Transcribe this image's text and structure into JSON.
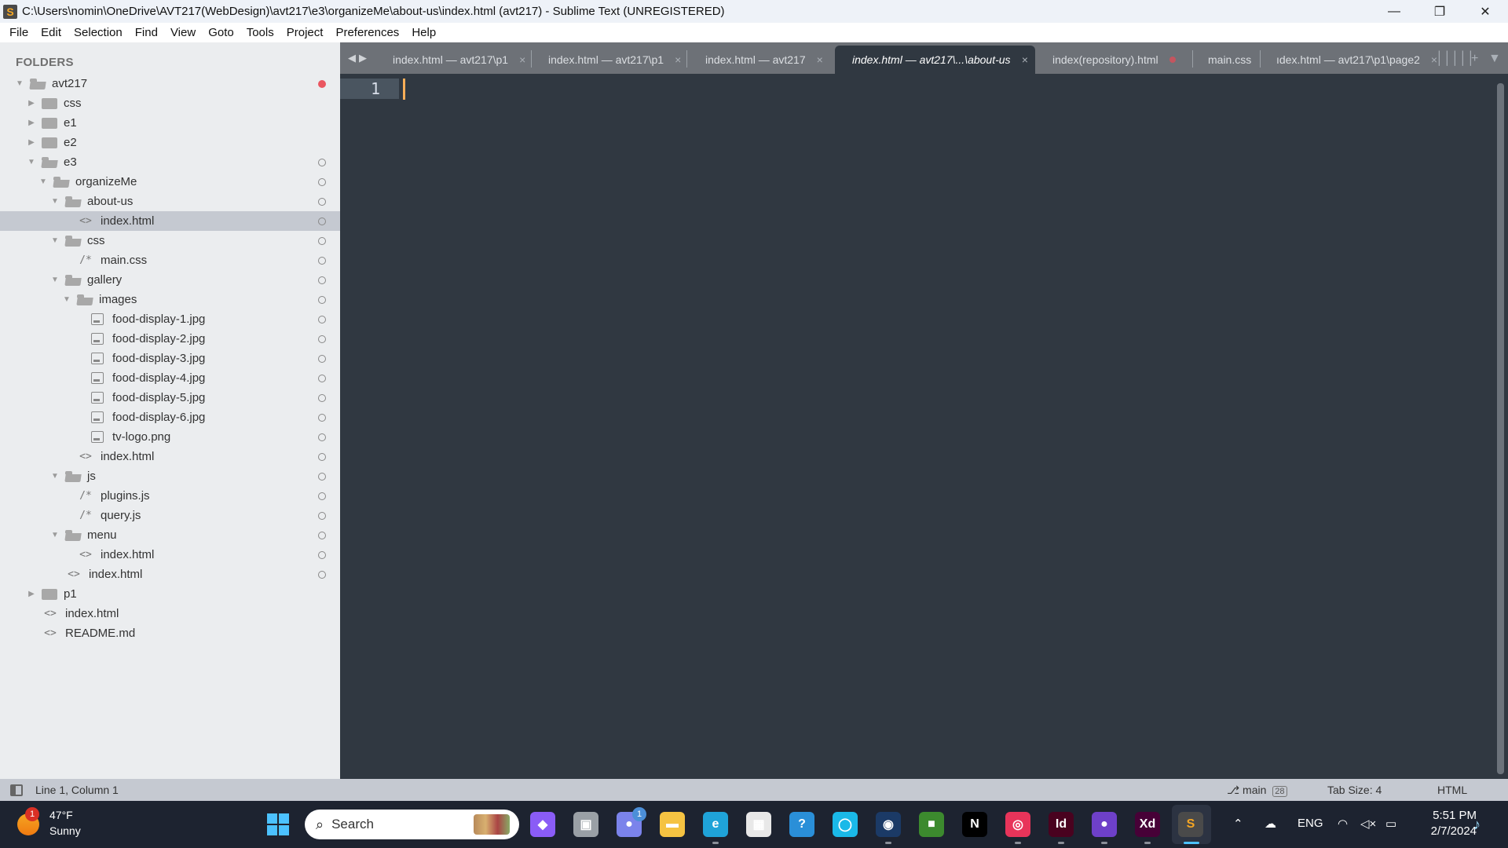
{
  "window": {
    "title": "C:\\Users\\nomin\\OneDrive\\AVT217(WebDesign)\\avt217\\e3\\organizeMe\\about-us\\index.html (avt217) - Sublime Text (UNREGISTERED)",
    "app_icon": "sublime-text-icon",
    "controls": {
      "minimize": "—",
      "maximize": "❐",
      "close": "✕"
    }
  },
  "menu": [
    "File",
    "Edit",
    "Selection",
    "Find",
    "View",
    "Goto",
    "Tools",
    "Project",
    "Preferences",
    "Help"
  ],
  "sidebar": {
    "header": "FOLDERS",
    "tree": [
      {
        "label": "avt217",
        "type": "folder",
        "open": true,
        "depth": 0,
        "status": "modified"
      },
      {
        "label": "css",
        "type": "folder",
        "open": false,
        "depth": 1,
        "status": ""
      },
      {
        "label": "e1",
        "type": "folder",
        "open": false,
        "depth": 1,
        "status": ""
      },
      {
        "label": "e2",
        "type": "folder",
        "open": false,
        "depth": 1,
        "status": ""
      },
      {
        "label": "e3",
        "type": "folder",
        "open": true,
        "depth": 1,
        "status": "clean"
      },
      {
        "label": "organizeMe",
        "type": "folder",
        "open": true,
        "depth": 2,
        "status": "clean"
      },
      {
        "label": "about-us",
        "type": "folder",
        "open": true,
        "depth": 3,
        "status": "clean"
      },
      {
        "label": "index.html",
        "type": "html",
        "depth": 4,
        "status": "clean",
        "selected": true
      },
      {
        "label": "css",
        "type": "folder",
        "open": true,
        "depth": 3,
        "status": "clean"
      },
      {
        "label": "main.css",
        "type": "code",
        "depth": 4,
        "status": "clean"
      },
      {
        "label": "gallery",
        "type": "folder",
        "open": true,
        "depth": 3,
        "status": "clean"
      },
      {
        "label": "images",
        "type": "folder",
        "open": true,
        "depth": 4,
        "status": "clean"
      },
      {
        "label": "food-display-1.jpg",
        "type": "image",
        "depth": 5,
        "status": "clean"
      },
      {
        "label": "food-display-2.jpg",
        "type": "image",
        "depth": 5,
        "status": "clean"
      },
      {
        "label": "food-display-3.jpg",
        "type": "image",
        "depth": 5,
        "status": "clean"
      },
      {
        "label": "food-display-4.jpg",
        "type": "image",
        "depth": 5,
        "status": "clean"
      },
      {
        "label": "food-display-5.jpg",
        "type": "image",
        "depth": 5,
        "status": "clean"
      },
      {
        "label": "food-display-6.jpg",
        "type": "image",
        "depth": 5,
        "status": "clean"
      },
      {
        "label": "tv-logo.png",
        "type": "image",
        "depth": 5,
        "status": "clean"
      },
      {
        "label": "index.html",
        "type": "html",
        "depth": 4,
        "status": "clean"
      },
      {
        "label": "js",
        "type": "folder",
        "open": true,
        "depth": 3,
        "status": "clean"
      },
      {
        "label": "plugins.js",
        "type": "code",
        "depth": 4,
        "status": "clean"
      },
      {
        "label": "query.js",
        "type": "code",
        "depth": 4,
        "status": "clean"
      },
      {
        "label": "menu",
        "type": "folder",
        "open": true,
        "depth": 3,
        "status": "clean"
      },
      {
        "label": "index.html",
        "type": "html",
        "depth": 4,
        "status": "clean"
      },
      {
        "label": "index.html",
        "type": "html",
        "depth": 3,
        "status": "clean"
      },
      {
        "label": "p1",
        "type": "folder",
        "open": false,
        "depth": 1,
        "status": ""
      },
      {
        "label": "index.html",
        "type": "html",
        "depth": 1,
        "status": ""
      },
      {
        "label": "README.md",
        "type": "html",
        "depth": 1,
        "status": ""
      }
    ]
  },
  "tabs": [
    {
      "label": "index.html — avt217\\p1",
      "indicator": "close",
      "active": false
    },
    {
      "label": "index.html — avt217\\p1",
      "indicator": "close",
      "active": false
    },
    {
      "label": "index.html — avt217",
      "indicator": "close",
      "active": false
    },
    {
      "label": "index.html — avt217\\...\\about-us",
      "indicator": "close",
      "active": true
    },
    {
      "label": "index(repository).html",
      "indicator": "dot-red",
      "active": false
    },
    {
      "label": "main.css",
      "indicator": "dot-gray",
      "active": false
    },
    {
      "label": "ıdex.html — avt217\\p1\\page2",
      "indicator": "close",
      "active": false
    }
  ],
  "tab_controls": {
    "nav": "◀▶",
    "new_tab": "+",
    "overflow": "▼"
  },
  "editor": {
    "line_number": "1",
    "content": ""
  },
  "statusbar": {
    "position": "Line 1, Column 1",
    "branch": "main",
    "branch_changes": "28",
    "tab_size": "Tab Size: 4",
    "syntax": "HTML"
  },
  "taskbar": {
    "weather": {
      "temp": "47°F",
      "condition": "Sunny",
      "badge": "1"
    },
    "search_label": "Search",
    "apps": [
      {
        "name": "copilot",
        "glyph": "◆",
        "color": "#8a5cf6"
      },
      {
        "name": "task-view",
        "glyph": "▣",
        "color": "#9aa0a6"
      },
      {
        "name": "teams",
        "glyph": "●",
        "color": "#7b83eb",
        "badge": "1"
      },
      {
        "name": "file-explorer",
        "glyph": "▬",
        "color": "#f5c342"
      },
      {
        "name": "edge",
        "glyph": "e",
        "color": "#1fa3d8",
        "running": true
      },
      {
        "name": "microsoft-store",
        "glyph": "▦",
        "color": "#e8e8e8"
      },
      {
        "name": "get-help",
        "glyph": "?",
        "color": "#2a8fd8"
      },
      {
        "name": "alexa",
        "glyph": "◯",
        "color": "#1ab9e8"
      },
      {
        "name": "steam",
        "glyph": "◉",
        "color": "#1b3a66",
        "running": true
      },
      {
        "name": "minecraft",
        "glyph": "■",
        "color": "#3c8a2e"
      },
      {
        "name": "netflix",
        "glyph": "N",
        "color": "#000000"
      },
      {
        "name": "creative-cloud",
        "glyph": "◎",
        "color": "#e8345a",
        "running": true
      },
      {
        "name": "indesign",
        "glyph": "Id",
        "color": "#49021f",
        "running": true
      },
      {
        "name": "github-desktop",
        "glyph": "●",
        "color": "#6e40c9",
        "running": true
      },
      {
        "name": "adobe-xd",
        "glyph": "Xd",
        "color": "#470137",
        "running": true
      },
      {
        "name": "sublime-text",
        "glyph": "S",
        "color": "#4a4a4a",
        "active": true
      }
    ],
    "tray": {
      "lang": "ENG",
      "time": "5:51 PM",
      "date": "2/7/2024"
    }
  }
}
